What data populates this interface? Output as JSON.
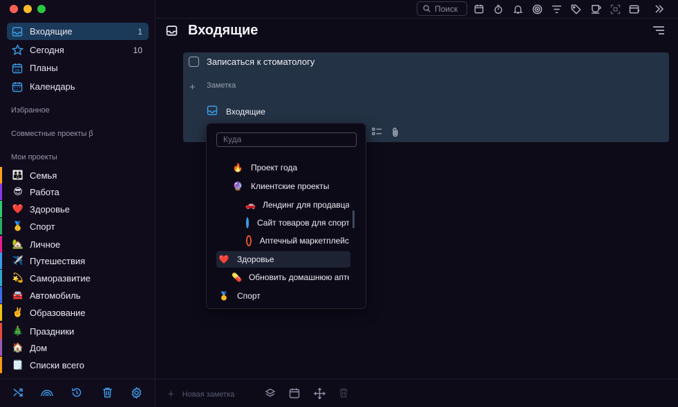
{
  "window": {
    "traffic_colors": [
      "#ff5f57",
      "#febc2e",
      "#28c840"
    ]
  },
  "sidebar": {
    "nav": [
      {
        "label": "Входящие",
        "count": "1",
        "icon": "inbox-icon"
      },
      {
        "label": "Сегодня",
        "count": "10",
        "icon": "star-icon"
      },
      {
        "label": "Планы",
        "count": "",
        "icon": "calendar-date-icon"
      },
      {
        "label": "Календарь",
        "count": "",
        "icon": "calendar-icon"
      }
    ],
    "favorites_title": "Избранное",
    "shared_title": "Совместные проекты β",
    "my_projects_title": "Мои проекты",
    "projects": [
      {
        "emoji": "👪",
        "label": "Семья",
        "color": "#ff9f1a"
      },
      {
        "emoji": "😎",
        "label": "Работа",
        "color": "#8a3ae8"
      },
      {
        "emoji": "❤️",
        "label": "Здоровье",
        "color": "#2ecc71"
      },
      {
        "emoji": "🥇",
        "label": "Спорт",
        "color": "#27ae60"
      },
      {
        "emoji": "🏡",
        "label": "Личное",
        "color": "#e91e8c"
      },
      {
        "emoji": "✈️",
        "label": "Путешествия",
        "color": "#3b9ce8"
      },
      {
        "emoji": "💫",
        "label": "Саморазвитие",
        "color": "#2fa8c9"
      },
      {
        "emoji": "🚘",
        "label": "Автомобиль",
        "color": "#3b6de8"
      },
      {
        "emoji": "✌️",
        "label": "Образование",
        "color": "#f1c40f"
      },
      {
        "emoji": "🎄",
        "label": "Праздники",
        "color": "#e74c3c"
      },
      {
        "emoji": "🏠",
        "label": "Дом",
        "color": "#9b59b6"
      },
      {
        "emoji": "🗒️",
        "label": "Списки всего",
        "color": "#f39c12"
      }
    ],
    "bottom_icons": [
      "shuffle-icon",
      "rainbow-icon",
      "history-icon",
      "trash-icon",
      "settings-icon"
    ]
  },
  "toolbar": {
    "search_placeholder": "Поиск",
    "icons": [
      "calendar-icon",
      "timer-icon",
      "bell-icon",
      "target-icon",
      "filter-icon",
      "tag-icon",
      "cup-icon",
      "focus-icon",
      "window-icon",
      "chevrons-right-icon"
    ]
  },
  "main": {
    "title": "Входящие",
    "task": {
      "title": "Записаться к стоматологу",
      "note_placeholder": "Заметка",
      "destination": "Входящие"
    }
  },
  "dropdown": {
    "search_placeholder": "Куда",
    "items": [
      {
        "emoji": "🔥",
        "label": "Проект года"
      },
      {
        "emoji": "🔮",
        "label": "Клиентские проекты"
      },
      {
        "emoji": "🚗",
        "label": "Лендинг для продавца"
      },
      {
        "emoji": "",
        "label": "Сайт товаров для спорта",
        "circle": "#3b9ce8"
      },
      {
        "emoji": "",
        "label": "Аптечный маркетплейс",
        "circle": "#e8552c"
      },
      {
        "emoji": "❤️",
        "label": "Здоровье"
      },
      {
        "emoji": "💊",
        "label": "Обновить домашнюю аптечку"
      },
      {
        "emoji": "🥇",
        "label": "Спорт"
      }
    ]
  },
  "bottom_bar": {
    "new_note_label": "Новая заметка"
  }
}
